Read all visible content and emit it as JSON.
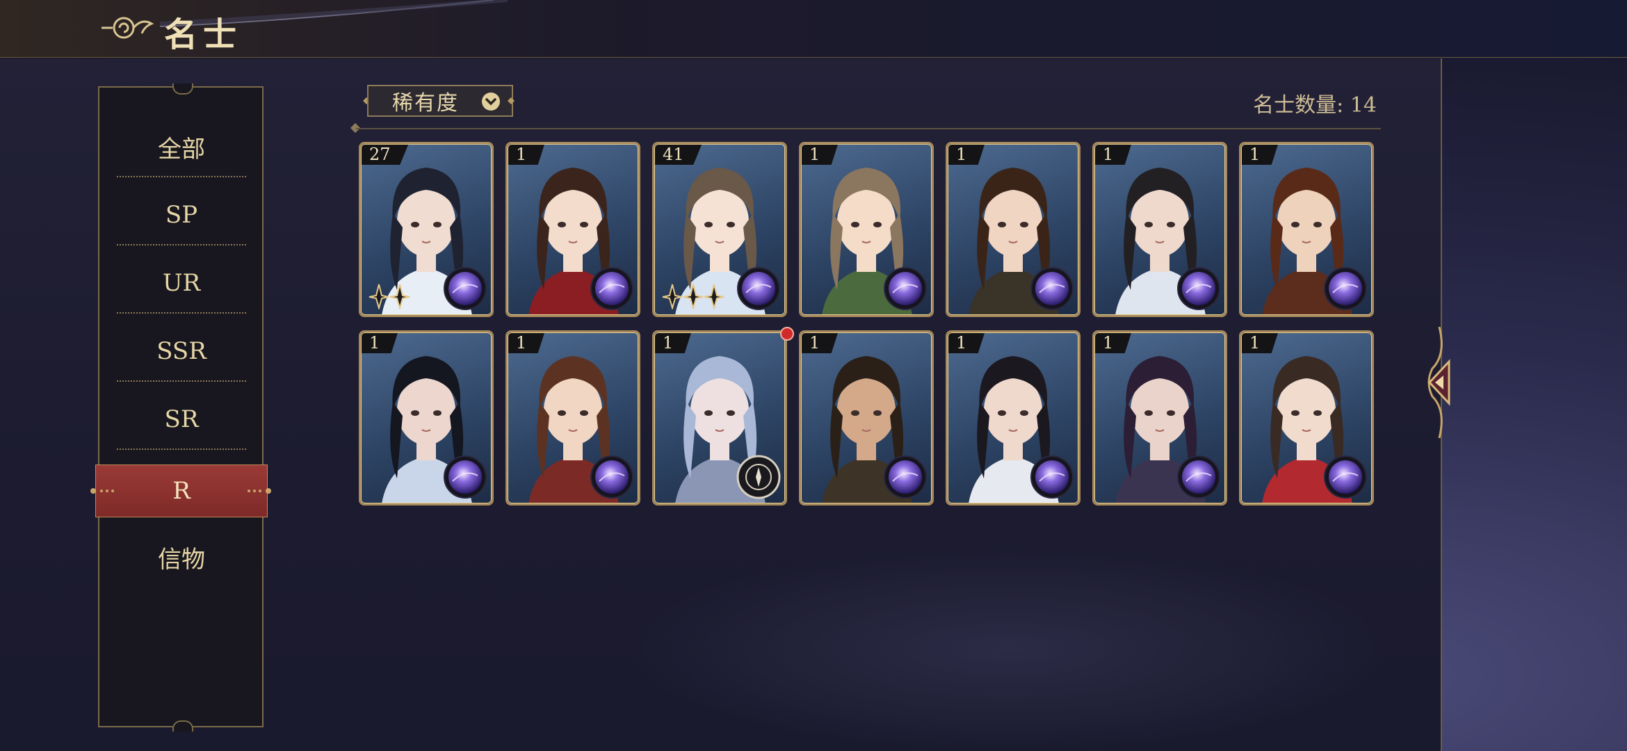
{
  "header": {
    "title": "名士",
    "back_icon": "cloud-swirl-back-icon"
  },
  "sidebar": {
    "items": [
      {
        "label": "全部"
      },
      {
        "label": "SP"
      },
      {
        "label": "UR"
      },
      {
        "label": "SSR"
      },
      {
        "label": "SR"
      },
      {
        "label": "R",
        "active": true
      },
      {
        "label": "信物"
      }
    ]
  },
  "filter": {
    "label": "稀有度",
    "icon": "chevron-down-circle-icon"
  },
  "count": {
    "label": "名士数量: 14"
  },
  "cards": [
    {
      "level": "27",
      "hair": "#1f2230",
      "skin": "#f0dcd0",
      "outfit": "#e8eef5",
      "stars": 2
    },
    {
      "level": "1",
      "hair": "#3b241c",
      "skin": "#f3dccb",
      "outfit": "#8a1e22",
      "stars": 0
    },
    {
      "level": "41",
      "hair": "#6a5848",
      "skin": "#f5e2d5",
      "outfit": "#d9e4f2",
      "stars": 3
    },
    {
      "level": "1",
      "hair": "#8b7660",
      "skin": "#f4dcc8",
      "outfit": "#4b6b3e",
      "stars": 0
    },
    {
      "level": "1",
      "hair": "#3a2418",
      "skin": "#efd5c2",
      "outfit": "#3a3328",
      "stars": 0
    },
    {
      "level": "1",
      "hair": "#232024",
      "skin": "#efd9cd",
      "outfit": "#dfe5ef",
      "stars": 0
    },
    {
      "level": "1",
      "hair": "#5a2a18",
      "skin": "#eed2bc",
      "outfit": "#5c2c1c",
      "stars": 0
    },
    {
      "level": "1",
      "hair": "#141620",
      "skin": "#ecd6cd",
      "outfit": "#c9d6ea",
      "stars": 0
    },
    {
      "level": "1",
      "hair": "#5c3322",
      "skin": "#f1d6c4",
      "outfit": "#7c2a26",
      "stars": 0
    },
    {
      "level": "1",
      "hair": "#a9b8d6",
      "skin": "#eee0e0",
      "outfit": "#8b96b5",
      "stars": 0
    },
    {
      "level": "1",
      "hair": "#2b2018",
      "skin": "#d3a98a",
      "outfit": "#3d3326",
      "stars": 0
    },
    {
      "level": "1",
      "hair": "#1c1820",
      "skin": "#efd8cc",
      "outfit": "#e6e9f0",
      "stars": 0
    },
    {
      "level": "1",
      "hair": "#2b1e35",
      "skin": "#ead3ca",
      "outfit": "#3b3450",
      "stars": 0
    },
    {
      "level": "1",
      "hair": "#3a2a24",
      "skin": "#f0dbcc",
      "outfit": "#b22a30",
      "stars": 0
    }
  ],
  "colors": {
    "accent_gold": "#e7d6a6",
    "active_red": "#8a2f2c",
    "badge_red": "#d12a2a"
  }
}
